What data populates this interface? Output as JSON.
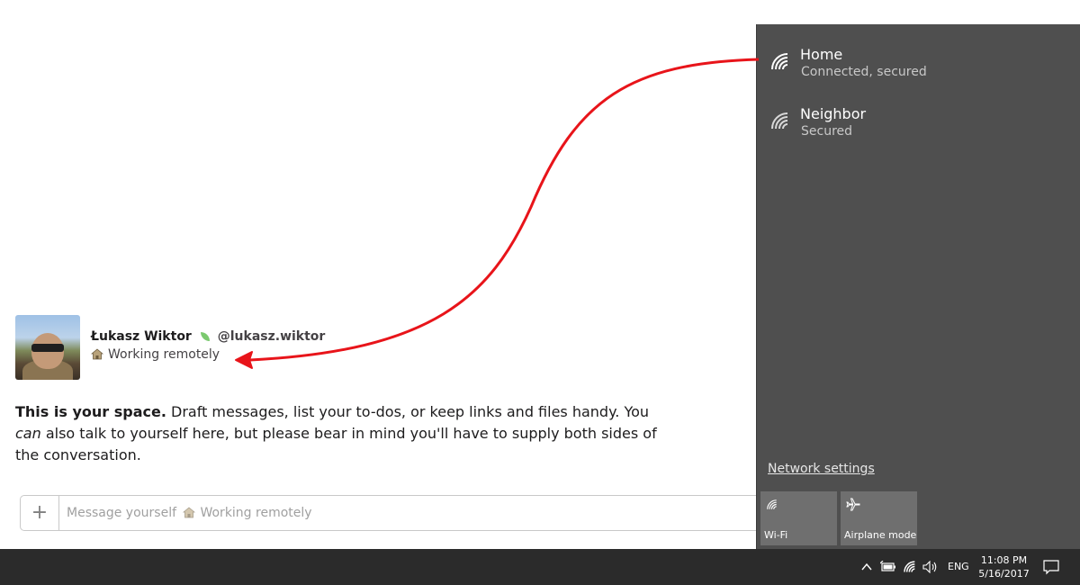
{
  "profile": {
    "name": "Łukasz Wiktor",
    "handle": "@lukasz.wiktor",
    "status_text": "Working remotely"
  },
  "intro": {
    "bold": "This is your space.",
    "part1": " Draft messages, list your to-dos, or keep links and files handy. You ",
    "em": "can",
    "part2": " also talk to yourself here, but please bear in mind you'll have to supply both sides of the conversation."
  },
  "composer": {
    "plus": "+",
    "placeholder_prefix": "Message yourself",
    "placeholder_status": "Working remotely"
  },
  "network_flyout": {
    "networks": [
      {
        "ssid": "Home",
        "status": "Connected, secured",
        "icon": "wifi-icon"
      },
      {
        "ssid": "Neighbor",
        "status": "Secured",
        "icon": "wifi-icon"
      }
    ],
    "settings_link": "Network settings",
    "tiles": [
      {
        "label": "Wi-Fi",
        "icon": "wifi-icon"
      },
      {
        "label": "Airplane mode",
        "icon": "airplane-icon"
      }
    ]
  },
  "taskbar": {
    "language": "ENG",
    "time": "11:08 PM",
    "date": "5/16/2017"
  },
  "colors": {
    "flyout_bg": "#4f4f4f",
    "tile_bg": "#6f6f6f",
    "taskbar_bg": "#2b2b2b",
    "arrow": "#e8141a"
  }
}
